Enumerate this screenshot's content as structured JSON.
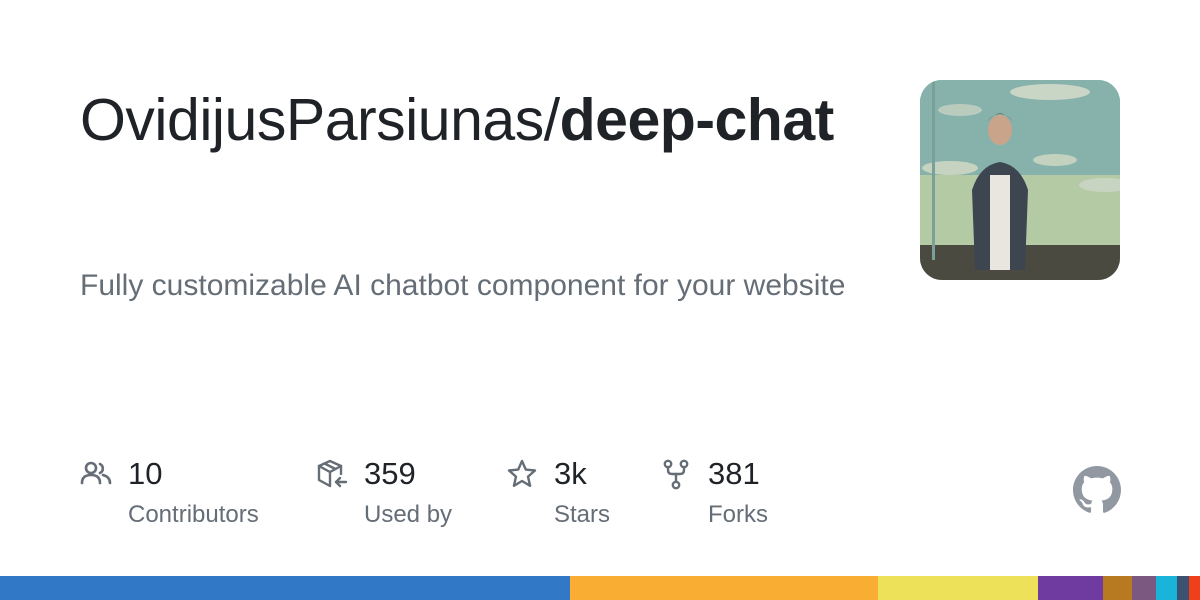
{
  "repo": {
    "owner": "OvidijusParsiunas",
    "separator": "/",
    "name": "deep-chat",
    "description": "Fully customizable AI chatbot component for your website"
  },
  "avatar": {
    "alt": "owner avatar photo"
  },
  "stats": [
    {
      "key": "contributors",
      "icon": "people-icon",
      "value": "10",
      "label": "Contributors"
    },
    {
      "key": "used_by",
      "icon": "package-dependents-icon",
      "value": "359",
      "label": "Used by"
    },
    {
      "key": "stars",
      "icon": "star-icon",
      "value": "3k",
      "label": "Stars"
    },
    {
      "key": "forks",
      "icon": "repo-forked-icon",
      "value": "381",
      "label": "Forks"
    }
  ],
  "brand_icon": "github-mark-icon",
  "language_bar": [
    {
      "color": "#3178c6",
      "fraction": 0.475
    },
    {
      "color": "#f9ad33",
      "fraction": 0.257
    },
    {
      "color": "#ede15a",
      "fraction": 0.133
    },
    {
      "color": "#6f3ba0",
      "fraction": 0.054
    },
    {
      "color": "#b87a20",
      "fraction": 0.024
    },
    {
      "color": "#7b5880",
      "fraction": 0.02
    },
    {
      "color": "#1ab3da",
      "fraction": 0.018
    },
    {
      "color": "#3d5270",
      "fraction": 0.01
    },
    {
      "color": "#f0401b",
      "fraction": 0.009
    }
  ],
  "colors": {
    "text": "#1f2328",
    "muted": "#656d76",
    "icon": "#656d76"
  }
}
